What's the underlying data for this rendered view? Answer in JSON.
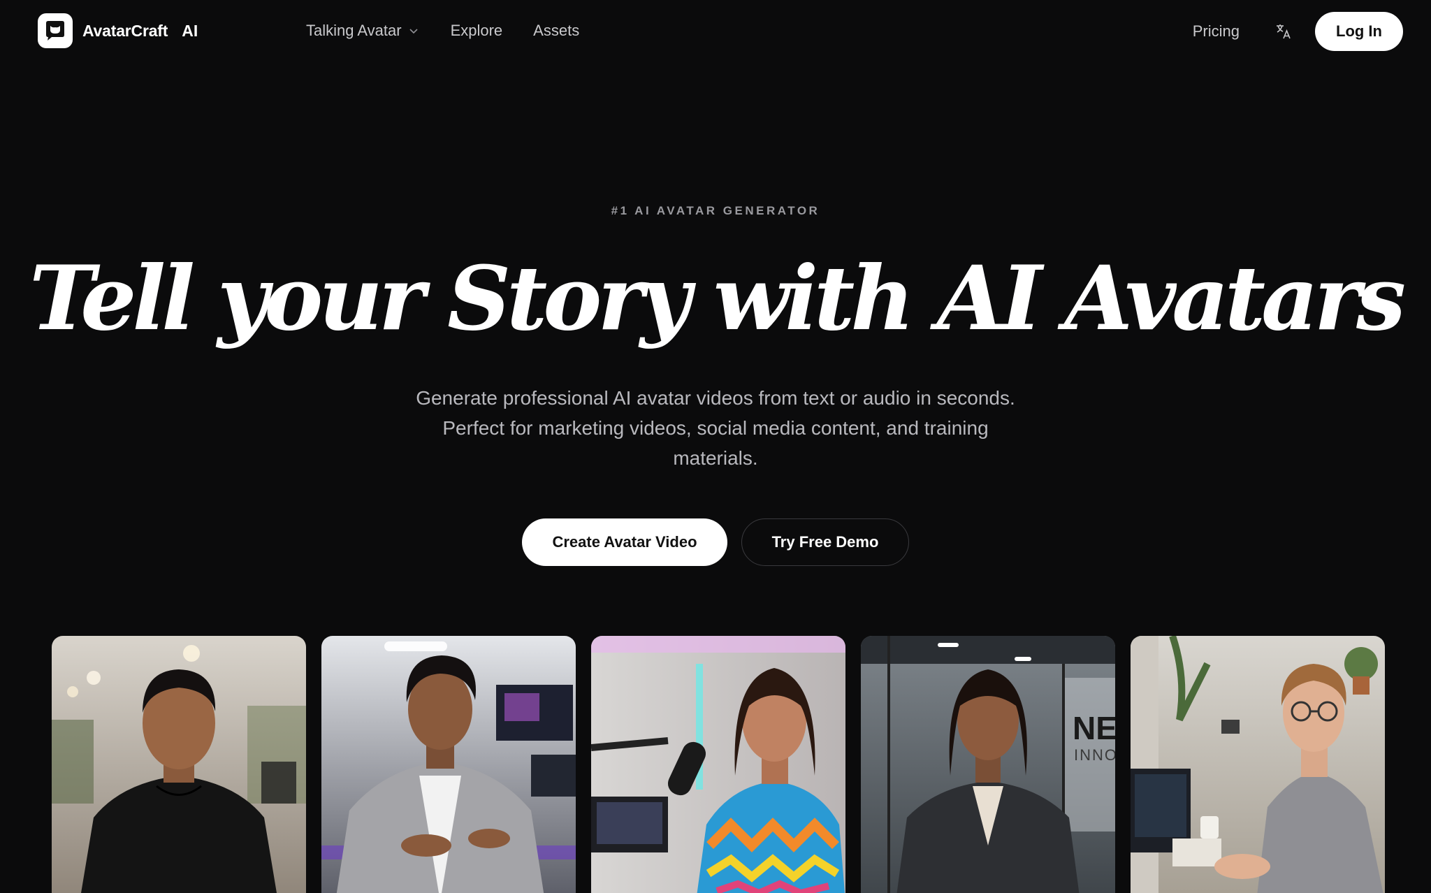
{
  "nav": {
    "brand_name": "AvatarCraft",
    "brand_suffix": "AI",
    "links": [
      {
        "label": "Talking Avatar",
        "has_dropdown": true
      },
      {
        "label": "Explore"
      },
      {
        "label": "Assets"
      }
    ],
    "pricing_label": "Pricing",
    "language_icon": "translate-icon",
    "login_label": "Log In"
  },
  "hero": {
    "eyebrow": "#1 AI AVATAR GENERATOR",
    "headline": "Tell your Story with AI Avatars",
    "subtitle": "Generate professional AI avatar videos from text or audio in seconds. Perfect for marketing videos, social media content, and training materials.",
    "primary_cta": "Create Avatar Video",
    "secondary_cta": "Try Free Demo"
  },
  "avatars": [
    {
      "name": "avatar-office-black-hoodie"
    },
    {
      "name": "avatar-studio-gray-hoodie"
    },
    {
      "name": "avatar-podcast-colorful-sweater",
      "visible_text": ""
    },
    {
      "name": "avatar-office-blazer",
      "wall_text": "NE",
      "wall_subtext": "INNO"
    },
    {
      "name": "avatar-desk-glasses"
    }
  ],
  "colors": {
    "background": "#0b0b0c",
    "button_primary_bg": "#ffffff",
    "nav_text": "#c9c9cc",
    "muted_text": "#9a9a9f"
  }
}
